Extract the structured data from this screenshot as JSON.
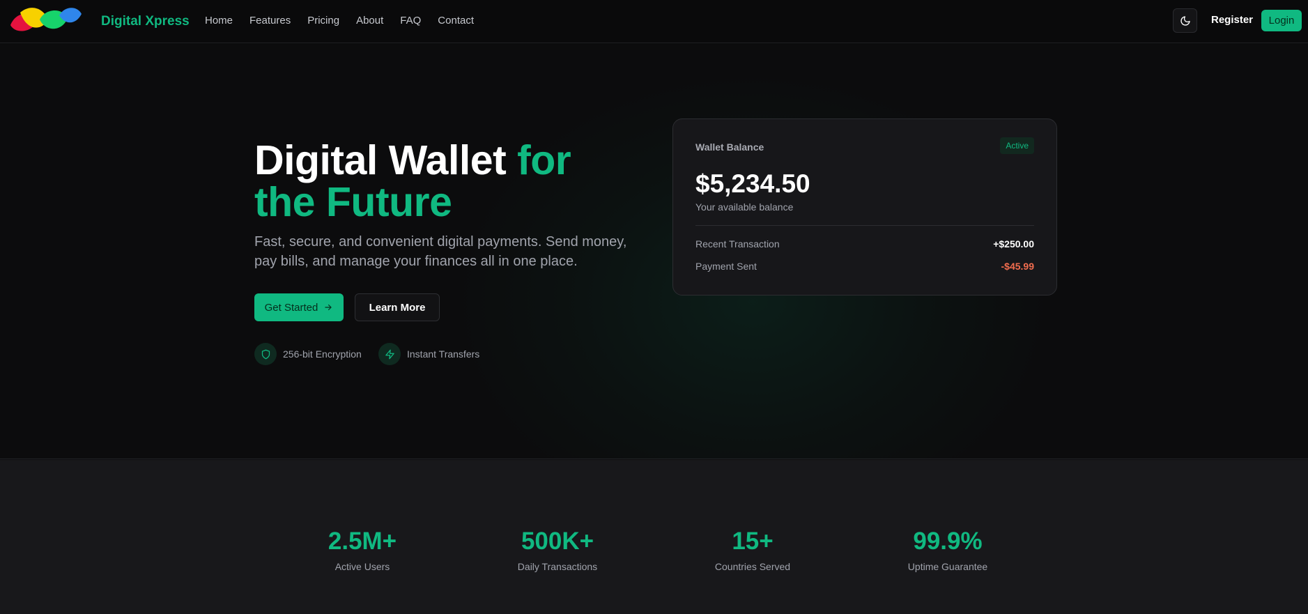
{
  "brand": {
    "name": "Digital Xpress"
  },
  "nav": {
    "links": [
      "Home",
      "Features",
      "Pricing",
      "About",
      "FAQ",
      "Contact"
    ],
    "register_label": "Register",
    "login_label": "Login",
    "theme_icon": "moon-icon"
  },
  "hero": {
    "title_part1": "Digital Wallet ",
    "title_accent": "for the Future",
    "subtitle": "Fast, secure, and convenient digital payments. Send money, pay bills, and manage your finances all in one place.",
    "cta_primary": "Get Started",
    "cta_secondary": "Learn More",
    "features": [
      {
        "icon": "shield-icon",
        "label": "256-bit Encryption"
      },
      {
        "icon": "lightning-icon",
        "label": "Instant Transfers"
      }
    ]
  },
  "wallet": {
    "title": "Wallet Balance",
    "status": "Active",
    "balance": "$5,234.50",
    "balance_caption": "Your available balance",
    "rows": [
      {
        "label": "Recent Transaction",
        "amount": "+$250.00",
        "color": "#ffffff"
      },
      {
        "label": "Payment Sent",
        "amount": "-$45.99",
        "color": "#f26d4f"
      }
    ]
  },
  "stats": [
    {
      "value": "2.5M+",
      "label": "Active Users"
    },
    {
      "value": "500K+",
      "label": "Daily Transactions"
    },
    {
      "value": "15+",
      "label": "Countries Served"
    },
    {
      "value": "99.9%",
      "label": "Uptime Guarantee"
    }
  ],
  "colors": {
    "accent": "#10b981",
    "negative": "#f26d4f",
    "background": "#0c0c0d"
  }
}
